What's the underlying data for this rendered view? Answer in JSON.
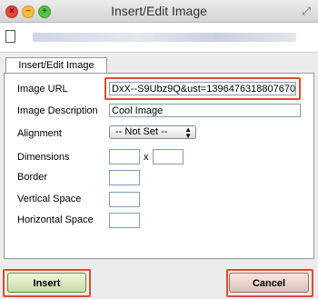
{
  "window": {
    "title": "Insert/Edit Image"
  },
  "tab": {
    "label": "Insert/Edit Image"
  },
  "form": {
    "image_url_label": "Image URL",
    "image_url_value": "DxX--S9Ubz9Q&ust=1396476318807670",
    "image_description_label": "Image Description",
    "image_description_value": "Cool Image",
    "alignment_label": "Alignment",
    "alignment_value": "-- Not Set --",
    "dimensions_label": "Dimensions",
    "dimensions_separator": "x",
    "border_label": "Border",
    "vertical_space_label": "Vertical Space",
    "horizontal_space_label": "Horizontal Space"
  },
  "buttons": {
    "insert": "Insert",
    "cancel": "Cancel"
  },
  "colors": {
    "highlight": "#e04a2f"
  }
}
